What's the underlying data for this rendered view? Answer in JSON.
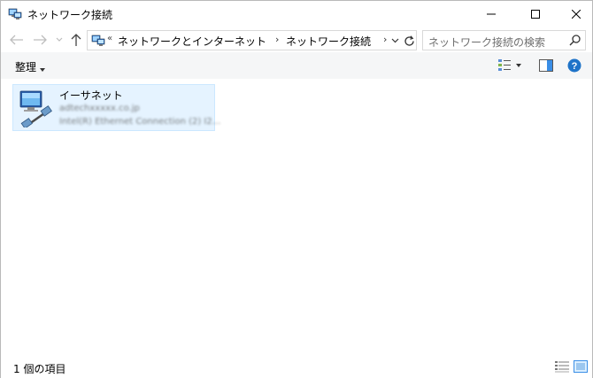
{
  "window": {
    "title": "ネットワーク接続",
    "controls": {
      "minimize": "minimize",
      "maximize": "maximize",
      "close": "close"
    }
  },
  "navigation": {
    "breadcrumbs": [
      "ネットワークとインターネット",
      "ネットワーク接続"
    ],
    "overflow_marker": "«",
    "separator": "›"
  },
  "search": {
    "placeholder": "ネットワーク接続の検索"
  },
  "command_bar": {
    "organize_label": "整理"
  },
  "items": [
    {
      "name": "イーサネット",
      "network": "adtechxxxxx.co.jp",
      "device": "Intel(R) Ethernet Connection (2) I2..."
    }
  ],
  "status": {
    "item_count_text": "1 個の項目"
  },
  "colors": {
    "selection_fill": "#e5f3ff",
    "selection_border": "#cce8ff",
    "help_blue": "#1e73c8",
    "command_bar_bg": "#f5f6f7"
  },
  "icons": {
    "title": "network-connections-icon",
    "address": "network-connections-icon",
    "item": "ethernet-adapter-icon"
  }
}
